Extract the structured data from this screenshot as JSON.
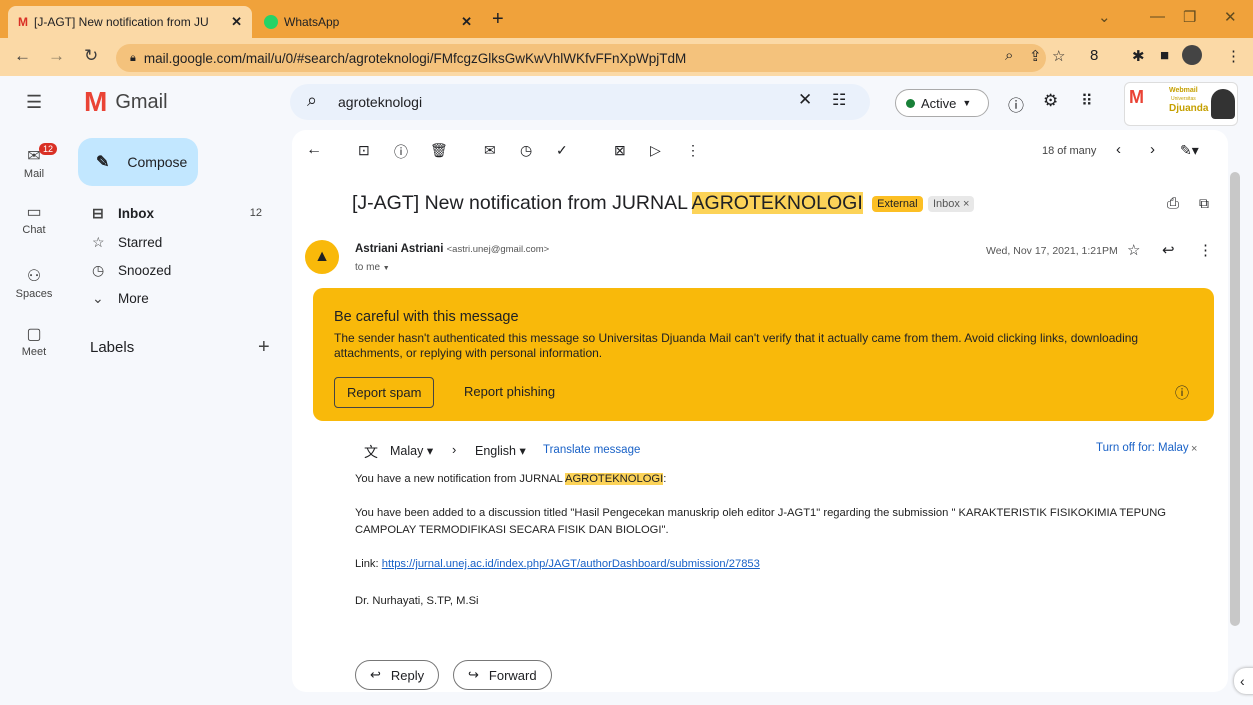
{
  "browser": {
    "tabs": [
      {
        "title": "[J-AGT] New notification from JU",
        "icon": "gmail-icon"
      },
      {
        "title": "WhatsApp",
        "icon": "whatsapp-icon"
      }
    ],
    "new_tab": "+",
    "url": "mail.google.com/mail/u/0/#search/agroteknologi/FMfcgzGlksGwKwVhlWKfvFFnXpWpjTdM"
  },
  "gmail": {
    "brand": "Gmail",
    "rail": [
      {
        "label": "Mail",
        "badge": "12"
      },
      {
        "label": "Chat"
      },
      {
        "label": "Spaces"
      },
      {
        "label": "Meet"
      }
    ],
    "compose": "Compose",
    "nav": [
      {
        "label": "Inbox",
        "count": "12"
      },
      {
        "label": "Starred"
      },
      {
        "label": "Snoozed"
      },
      {
        "label": "More"
      }
    ],
    "labels": "Labels",
    "search_query": "agroteknologi",
    "status": "Active",
    "logo_text": {
      "top": "Webmail",
      "mid": "Universitas",
      "bottom": "Djuanda"
    },
    "pager": "18 of many"
  },
  "email": {
    "subject_prefix": "[J-AGT] New notification from JURNAL ",
    "subject_highlight": "AGROTEKNOLOGI",
    "tag_external": "External",
    "tag_inbox": "Inbox",
    "sender_name": "Astriani Astriani",
    "sender_email": "<astri.unej@gmail.com>",
    "to": "to me",
    "date": "Wed, Nov 17, 2021, 1:21PM",
    "warning_title": "Be careful with this message",
    "warning_body": "The sender hasn't authenticated this message so Universitas Djuanda Mail can't verify that it actually came from them. Avoid clicking links, downloading attachments, or replying with personal information.",
    "report_spam": "Report spam",
    "report_phishing": "Report phishing",
    "translate": {
      "from": "Malay",
      "to": "English",
      "action": "Translate message",
      "turn_off": "Turn off for: Malay"
    },
    "line1_prefix": "You have a new notification from JURNAL ",
    "line1_highlight": "AGROTEKNOLOGI",
    "line1_suffix": ":",
    "line2a": "You have been added to a discussion titled \"Hasil Pengecekan manuskrip oleh editor J-AGT1\" regarding the submission \" KARAKTERISTIK FISIKOKIMIA TEPUNG",
    "line2b": "CAMPOLAY TERMODIFIKASI SECARA FISIK DAN BIOLOGI\".",
    "link_label": "Link: ",
    "link_url": "https://jurnal.unej.ac.id/index.php/JAGT/authorDashboard/submission/27853",
    "signature": "Dr. Nurhayati, S.TP, M.Si",
    "reply": "Reply",
    "forward": "Forward"
  },
  "colors": {
    "tabbar": "#f0a23b",
    "warning": "#f9b90a",
    "compose": "#c2e7ff",
    "highlight": "#fcd358"
  }
}
